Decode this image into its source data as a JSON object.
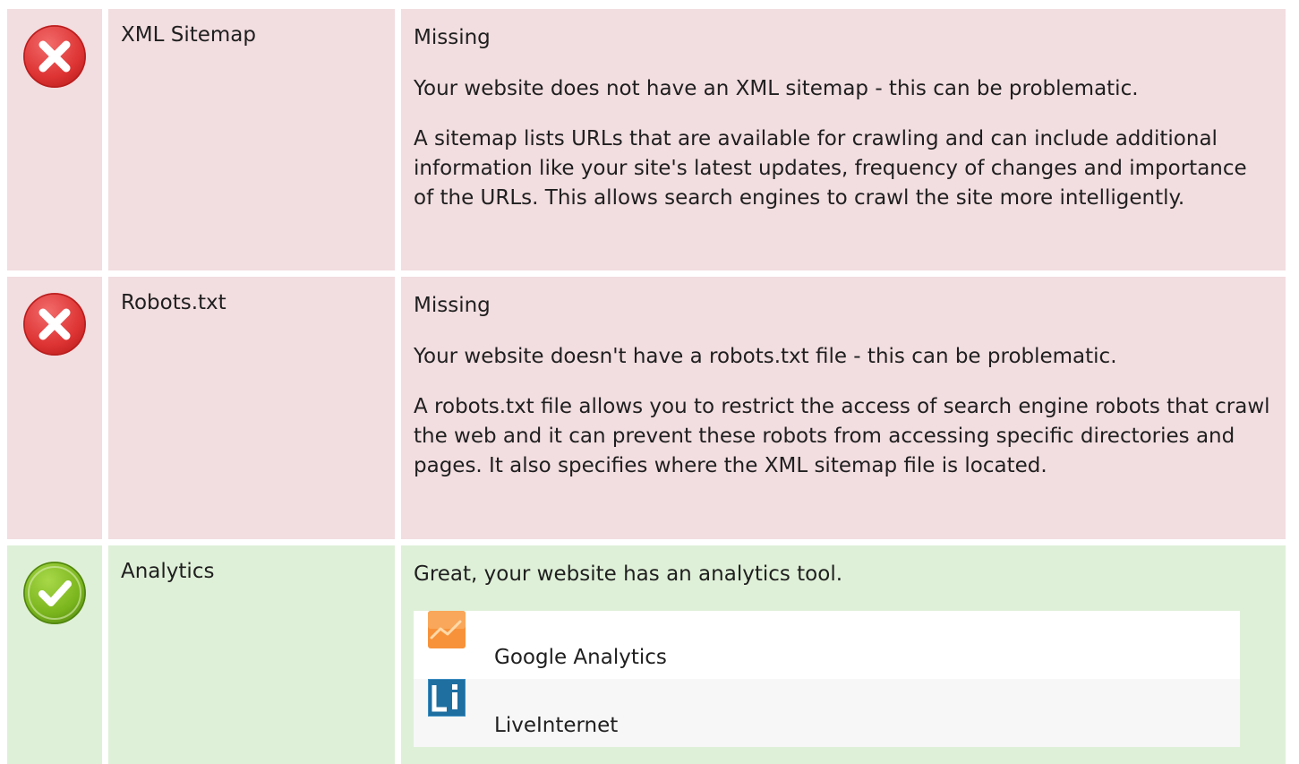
{
  "colors": {
    "error_row_bg": "#f2dde0",
    "success_row_bg": "#dff0d8",
    "error_icon": "#e23a3a",
    "success_icon": "#7ab51d"
  },
  "checks": [
    {
      "status": "error",
      "icon": "error-x-icon",
      "label": "XML Sitemap",
      "status_text": "Missing",
      "paragraphs": [
        "Your website does not have an XML sitemap - this can be problematic.",
        "A sitemap lists URLs that are available for crawling and can include additional information like your site's latest updates, frequency of changes and importance of the URLs. This allows search engines to crawl the site more intelligently."
      ]
    },
    {
      "status": "error",
      "icon": "error-x-icon",
      "label": "Robots.txt",
      "status_text": "Missing",
      "paragraphs": [
        "Your website doesn't have a robots.txt file - this can be problematic.",
        "A robots.txt file allows you to restrict the access of search engine robots that crawl the web and it can prevent these robots from accessing specific directories and pages. It also specifies where the XML sitemap file is located."
      ]
    },
    {
      "status": "success",
      "icon": "success-check-icon",
      "label": "Analytics",
      "status_text": "Great, your website has an analytics tool.",
      "tools": [
        {
          "name": "Google Analytics",
          "icon": "google-analytics-icon"
        },
        {
          "name": "LiveInternet",
          "icon": "liveinternet-icon"
        }
      ]
    }
  ]
}
